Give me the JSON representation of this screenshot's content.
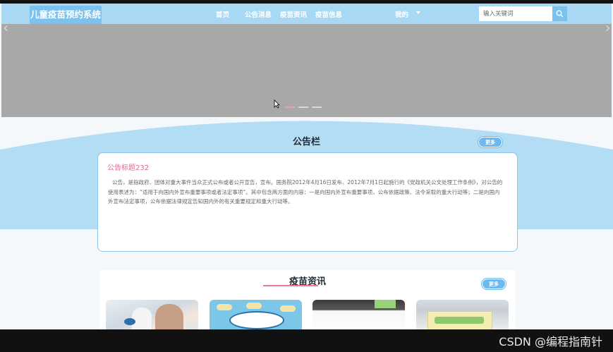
{
  "app": {
    "title": "儿童疫苗预约系统"
  },
  "nav": {
    "items": [
      "首页",
      "公告消息",
      "疫苗资讯",
      "疫苗信息"
    ],
    "me_label": "我的"
  },
  "search": {
    "placeholder": "输入关键词"
  },
  "banner": {
    "dots": 3,
    "active_dot": 1
  },
  "notice": {
    "section_title": "公告栏",
    "more_label": "更多",
    "heading": "公告标题232",
    "body": "公告，是指政府、团体对重大事件当众正式公布或者公开宣告，宣布。国务院2012年4月16日发布、2012年7月1日起施行的《党政机关公文处理工作条例》，对公告的使用表述为：“适用于向国内外宣布重要事项或者法定事项”。其中包含两方面的内容：一是向国内外宣布重要事项，公布依据政策、法令采取的重大行动等；二是向国内外宣布法定事项，公布依据法律规定告知国内外的有关重要规定和重大行动等。"
  },
  "news": {
    "section_title": "疫苗资讯",
    "more_label": "更多",
    "thumbs": [
      "news-thumb-1",
      "news-thumb-2",
      "news-thumb-3",
      "news-thumb-4"
    ]
  },
  "watermark": "CSDN @编程指南针",
  "colors": {
    "navbar": "#a9d8f5",
    "brand": "#7cc2ef",
    "accent_pink": "#e06c8f",
    "more_button": "#6db8ef",
    "wave": "#b3dcf5"
  }
}
